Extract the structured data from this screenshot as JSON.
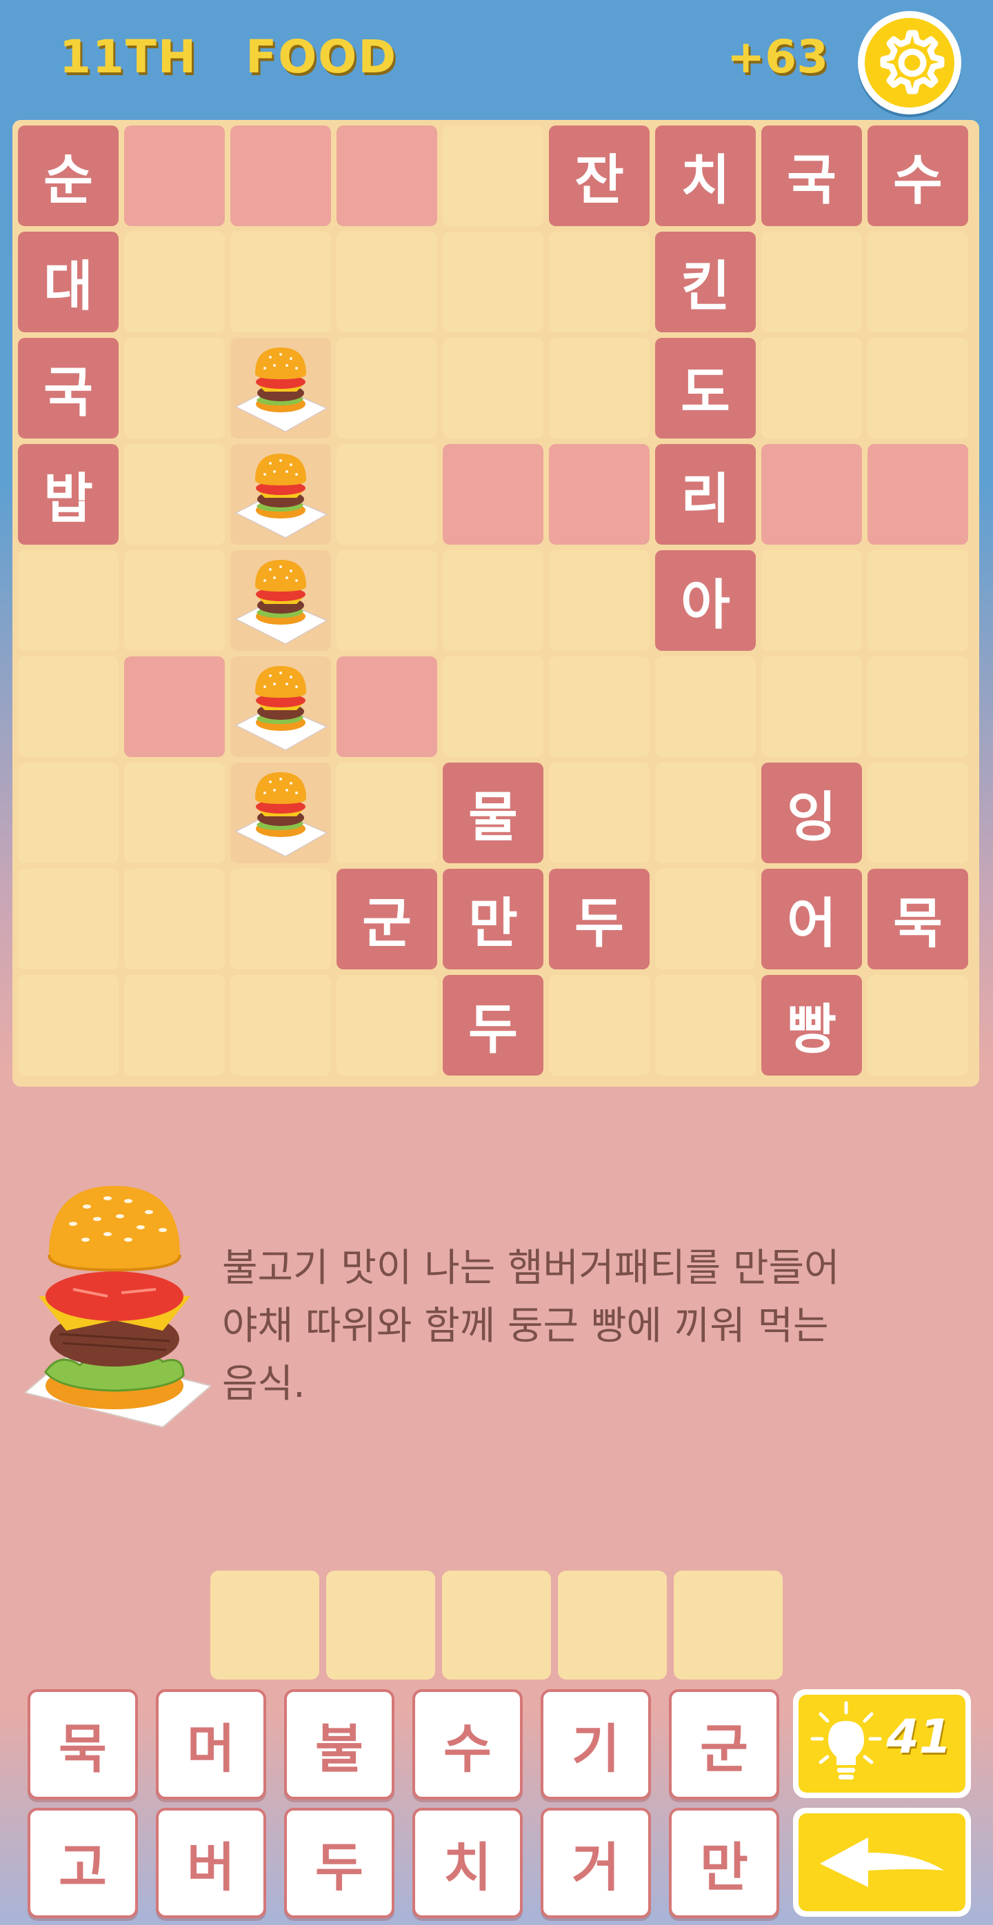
{
  "header": {
    "level": "11TH",
    "category": "FOOD",
    "score": "+63",
    "settings_icon": "gear-icon",
    "accent_color": "#f6d23a"
  },
  "board": {
    "cols": 9,
    "rows": 9,
    "cells": [
      [
        "순",
        "#",
        "#",
        "#",
        ".",
        "잔",
        "치",
        "국",
        "수"
      ],
      [
        "대",
        ".",
        ".",
        ".",
        ".",
        ".",
        "킨",
        ".",
        "."
      ],
      [
        "국",
        ".",
        "?",
        ".",
        ".",
        ".",
        "도",
        ".",
        "."
      ],
      [
        "밥",
        ".",
        "?",
        ".",
        "#",
        "#",
        "리",
        "#",
        "#"
      ],
      [
        ".",
        ".",
        "?",
        ".",
        ".",
        ".",
        "아",
        ".",
        "."
      ],
      [
        ".",
        "#",
        "?",
        "#",
        ".",
        ".",
        ".",
        ".",
        "."
      ],
      [
        ".",
        ".",
        "?",
        ".",
        "물",
        ".",
        ".",
        "잉",
        "."
      ],
      [
        ".",
        ".",
        ".",
        "군",
        "만",
        "두",
        ".",
        "어",
        "묵"
      ],
      [
        ".",
        ".",
        ".",
        ".",
        "두",
        ".",
        ".",
        "빵",
        "."
      ]
    ],
    "active_word_icon": "hamburger-icon"
  },
  "clue": {
    "image": "hamburger-icon",
    "text_lines": [
      "불고기 맛이 나는 햄버거패티를 만들어",
      "야채 따위와 함께 둥근 빵에 끼워 먹는",
      "음식."
    ]
  },
  "answer": {
    "slots": [
      "",
      "",
      "",
      "",
      ""
    ]
  },
  "keyboard": {
    "row1": [
      "묵",
      "머",
      "불",
      "수",
      "기",
      "군"
    ],
    "row2": [
      "고",
      "버",
      "두",
      "치",
      "거",
      "만"
    ],
    "hint_icon": "lightbulb-icon",
    "hint_count": "41",
    "back_icon": "back-arrow-icon"
  }
}
